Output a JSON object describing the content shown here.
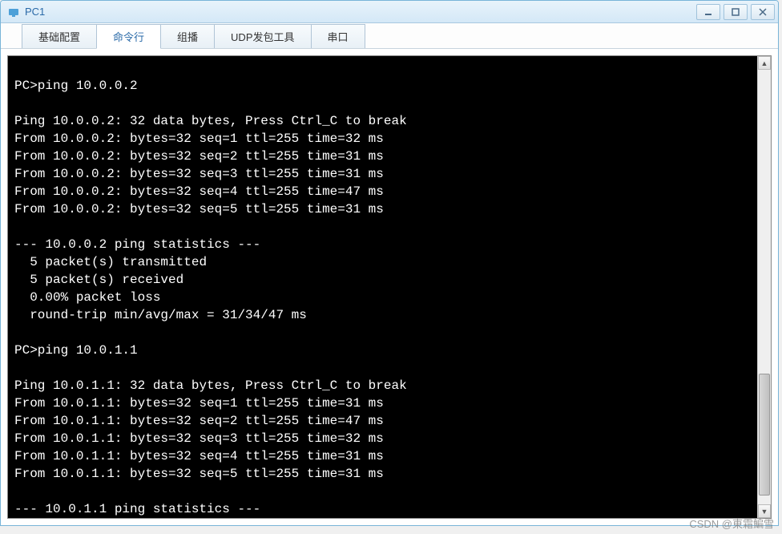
{
  "window": {
    "title": "PC1"
  },
  "tabs": [
    {
      "label": "基础配置",
      "active": false
    },
    {
      "label": "命令行",
      "active": true
    },
    {
      "label": "组播",
      "active": false
    },
    {
      "label": "UDP发包工具",
      "active": false
    },
    {
      "label": "串口",
      "active": false
    }
  ],
  "terminal": {
    "lines": [
      "",
      "PC>ping 10.0.0.2",
      "",
      "Ping 10.0.0.2: 32 data bytes, Press Ctrl_C to break",
      "From 10.0.0.2: bytes=32 seq=1 ttl=255 time=32 ms",
      "From 10.0.0.2: bytes=32 seq=2 ttl=255 time=31 ms",
      "From 10.0.0.2: bytes=32 seq=3 ttl=255 time=31 ms",
      "From 10.0.0.2: bytes=32 seq=4 ttl=255 time=47 ms",
      "From 10.0.0.2: bytes=32 seq=5 ttl=255 time=31 ms",
      "",
      "--- 10.0.0.2 ping statistics ---",
      "  5 packet(s) transmitted",
      "  5 packet(s) received",
      "  0.00% packet loss",
      "  round-trip min/avg/max = 31/34/47 ms",
      "",
      "PC>ping 10.0.1.1",
      "",
      "Ping 10.0.1.1: 32 data bytes, Press Ctrl_C to break",
      "From 10.0.1.1: bytes=32 seq=1 ttl=255 time=31 ms",
      "From 10.0.1.1: bytes=32 seq=2 ttl=255 time=47 ms",
      "From 10.0.1.1: bytes=32 seq=3 ttl=255 time=32 ms",
      "From 10.0.1.1: bytes=32 seq=4 ttl=255 time=31 ms",
      "From 10.0.1.1: bytes=32 seq=5 ttl=255 time=31 ms",
      "",
      "--- 10.0.1.1 ping statistics ---"
    ]
  },
  "watermark": "CSDN @東霜鯿雪"
}
